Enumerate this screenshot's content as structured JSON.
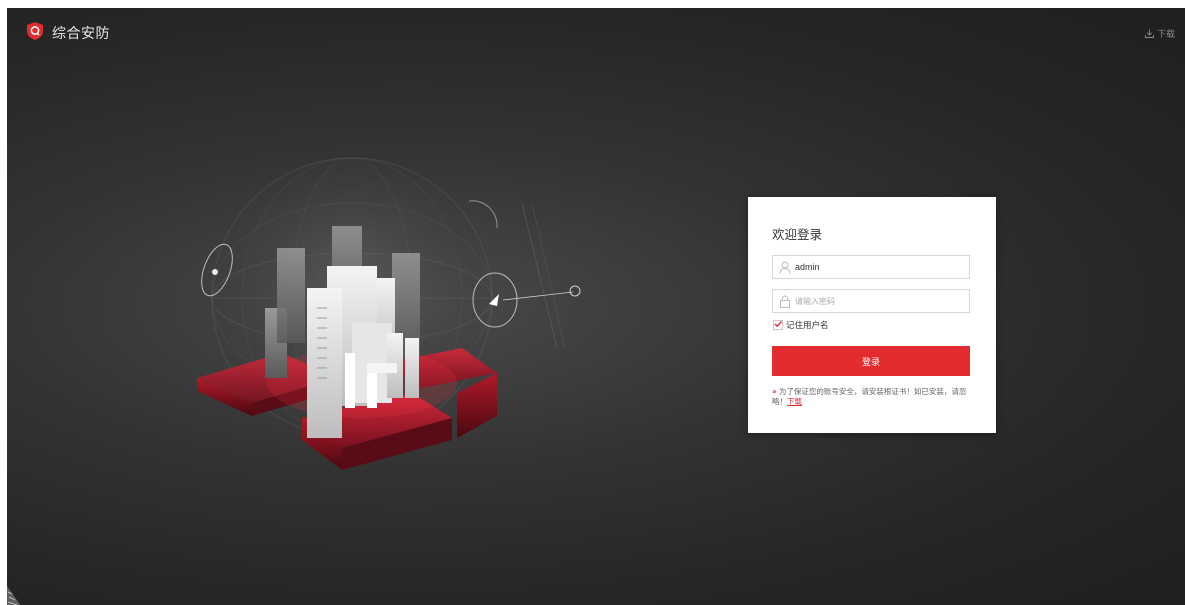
{
  "header": {
    "title": "综合安防",
    "download_label": "下载",
    "brand_color": "#e42c30"
  },
  "login": {
    "title": "欢迎登录",
    "username": {
      "value": "admin",
      "icon": "user-icon"
    },
    "password": {
      "value": "",
      "placeholder": "请输入密码",
      "icon": "lock-icon"
    },
    "remember": {
      "label": "记住用户名",
      "checked": true
    },
    "submit_label": "登录",
    "tip": {
      "text": "为了保证您的账号安全，请安装根证书！如已安装，请忽略！",
      "link_label": "下载"
    }
  },
  "colors": {
    "primary": "#e42c30",
    "background": "#2b2b2b"
  }
}
